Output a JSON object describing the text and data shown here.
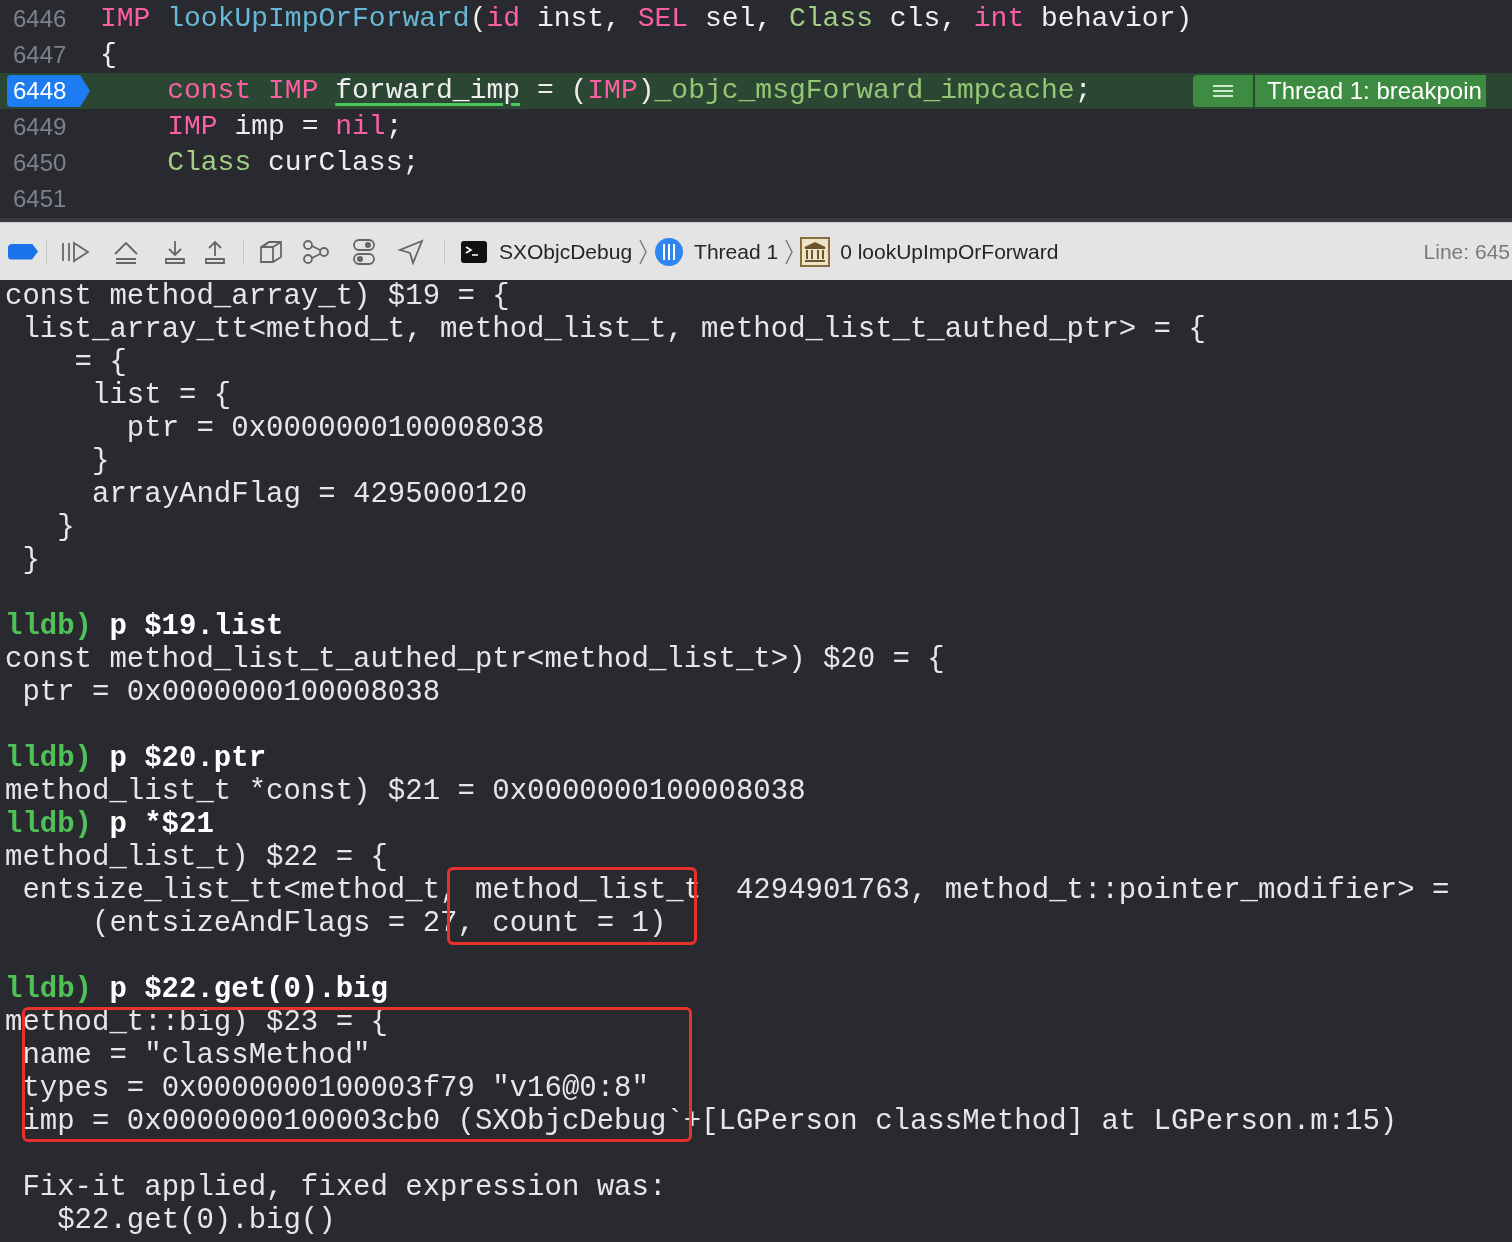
{
  "editor": {
    "lines": [
      {
        "number": "6446",
        "current": false,
        "indent": false,
        "tokens": [
          {
            "kind": "keyword",
            "text": "IMP "
          },
          {
            "kind": "function",
            "text": "lookUpImpOrForward"
          },
          {
            "kind": "plain",
            "text": "("
          },
          {
            "kind": "keyword",
            "text": "id"
          },
          {
            "kind": "plain",
            "text": " inst, "
          },
          {
            "kind": "keyword",
            "text": "SEL"
          },
          {
            "kind": "plain",
            "text": " sel, "
          },
          {
            "kind": "type",
            "text": "Class"
          },
          {
            "kind": "plain",
            "text": " cls, "
          },
          {
            "kind": "keyword",
            "text": "int"
          },
          {
            "kind": "plain",
            "text": " behavior)"
          }
        ]
      },
      {
        "number": "6447",
        "current": false,
        "indent": false,
        "tokens": [
          {
            "kind": "plain",
            "text": "{"
          }
        ]
      },
      {
        "number": "6448",
        "current": true,
        "indent": true,
        "tokens": [
          {
            "kind": "keyword",
            "text": "const "
          },
          {
            "kind": "keyword",
            "text": "IMP "
          },
          {
            "kind": "underlined",
            "text": "forward_imp"
          },
          {
            "kind": "plain",
            "text": " = ("
          },
          {
            "kind": "keyword",
            "text": "IMP"
          },
          {
            "kind": "plain",
            "text": ")"
          },
          {
            "kind": "macro",
            "text": "_objc_msgForward_impcache"
          },
          {
            "kind": "plain",
            "text": ";"
          }
        ]
      },
      {
        "number": "6449",
        "current": false,
        "indent": true,
        "tokens": [
          {
            "kind": "keyword",
            "text": "IMP"
          },
          {
            "kind": "plain",
            "text": " imp = "
          },
          {
            "kind": "keyword",
            "text": "nil"
          },
          {
            "kind": "plain",
            "text": ";"
          }
        ]
      },
      {
        "number": "6450",
        "current": false,
        "indent": true,
        "tokens": [
          {
            "kind": "type",
            "text": "Class"
          },
          {
            "kind": "plain",
            "text": " curClass;"
          }
        ]
      },
      {
        "number": "6451",
        "current": false
      }
    ],
    "banner": {
      "text": "Thread 1: breakpoin"
    }
  },
  "debug_bar": {
    "breakpoints_active": true,
    "breadcrumbs": [
      {
        "kind": "process",
        "label": "SXObjcDebug"
      },
      {
        "kind": "thread",
        "label": "Thread 1"
      },
      {
        "kind": "frame",
        "label": "0 lookUpImpOrForward"
      }
    ],
    "line_label": "Line: 645"
  },
  "console": {
    "lines": [
      {
        "kind": "output",
        "text": "const method_array_t) $19 = {"
      },
      {
        "kind": "output",
        "text": " list_array_tt<method_t, method_list_t, method_list_t_authed_ptr> = {"
      },
      {
        "kind": "output",
        "text": "    = {"
      },
      {
        "kind": "output",
        "text": "     list = {"
      },
      {
        "kind": "output",
        "text": "       ptr = 0x0000000100008038"
      },
      {
        "kind": "output",
        "text": "     }"
      },
      {
        "kind": "output",
        "text": "     arrayAndFlag = 4295000120"
      },
      {
        "kind": "output",
        "text": "   }"
      },
      {
        "kind": "output",
        "text": " }"
      },
      {
        "kind": "blank"
      },
      {
        "kind": "prompt",
        "prompt": "lldb)",
        "command": "p $19.list"
      },
      {
        "kind": "output",
        "text": "const method_list_t_authed_ptr<method_list_t>) $20 = {"
      },
      {
        "kind": "output",
        "text": " ptr = 0x0000000100008038"
      },
      {
        "kind": "blank"
      },
      {
        "kind": "prompt",
        "prompt": "lldb)",
        "command": "p $20.ptr"
      },
      {
        "kind": "output",
        "text": "method_list_t *const) $21 = 0x0000000100008038"
      },
      {
        "kind": "prompt",
        "prompt": "lldb)",
        "command": "p *$21"
      },
      {
        "kind": "output",
        "text": "method_list_t) $22 = {"
      },
      {
        "kind": "output",
        "text": " entsize_list_tt<method_t, method_list_t  4294901763, method_t::pointer_modifier> ="
      },
      {
        "kind": "output",
        "text": "     (entsizeAndFlags = 27, count = 1)"
      },
      {
        "kind": "blank"
      },
      {
        "kind": "prompt",
        "prompt": "lldb)",
        "command": "p $22.get(0).big"
      },
      {
        "kind": "output",
        "text": "method_t::big) $23 = {"
      },
      {
        "kind": "output",
        "text": " name = \"classMethod\""
      },
      {
        "kind": "output",
        "text": " types = 0x0000000100003f79 \"v16@0:8\""
      },
      {
        "kind": "output",
        "text": " imp = 0x0000000100003cb0 (SXObjcDebug`+[LGPerson classMethod] at LGPerson.m:15)"
      },
      {
        "kind": "blank"
      },
      {
        "kind": "output",
        "text": " Fix-it applied, fixed expression was:"
      },
      {
        "kind": "output",
        "text": "   $22.get(0).big()"
      }
    ]
  }
}
